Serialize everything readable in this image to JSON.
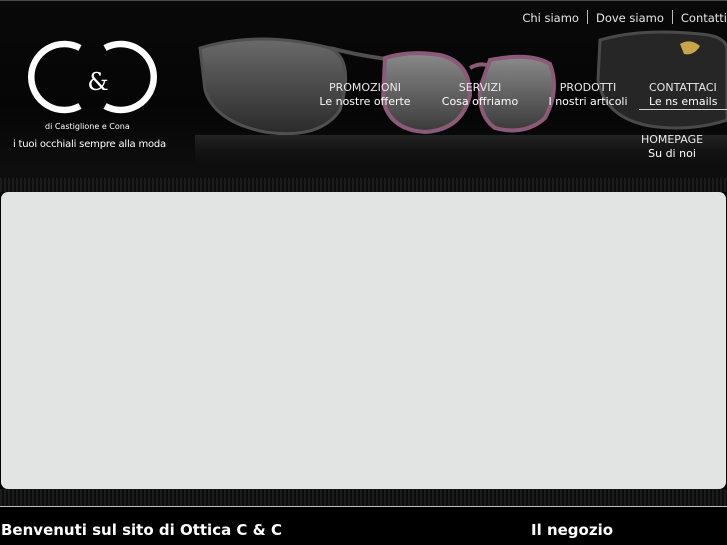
{
  "top_links": [
    "Chi siamo",
    "Dove siamo",
    "Contatti"
  ],
  "logo": {
    "mark": "C&C",
    "amp": "&",
    "tagline_small": "di Castiglione e Cona",
    "tagline": "i tuoi occhiali sempre alla moda"
  },
  "nav": [
    {
      "title": "PROMOZIONI",
      "subtitle": "Le nostre offerte"
    },
    {
      "title": "SERVIZI",
      "subtitle": "Cosa offriamo"
    },
    {
      "title": "PRODOTTI",
      "subtitle": "I nostri articoli"
    },
    {
      "title": "CONTATTACI",
      "subtitle": "Le ns emails"
    },
    {
      "title": "HOMEPAGE",
      "subtitle": "Su di noi"
    }
  ],
  "headings": {
    "welcome": "Benvenuti sul sito di Ottica C & C",
    "shop": "Il negozio"
  },
  "colors": {
    "background": "#000000",
    "content_panel": "#e2e4e3",
    "text": "#ffffff"
  },
  "icons": [
    "logo-image",
    "sunglasses-image"
  ]
}
